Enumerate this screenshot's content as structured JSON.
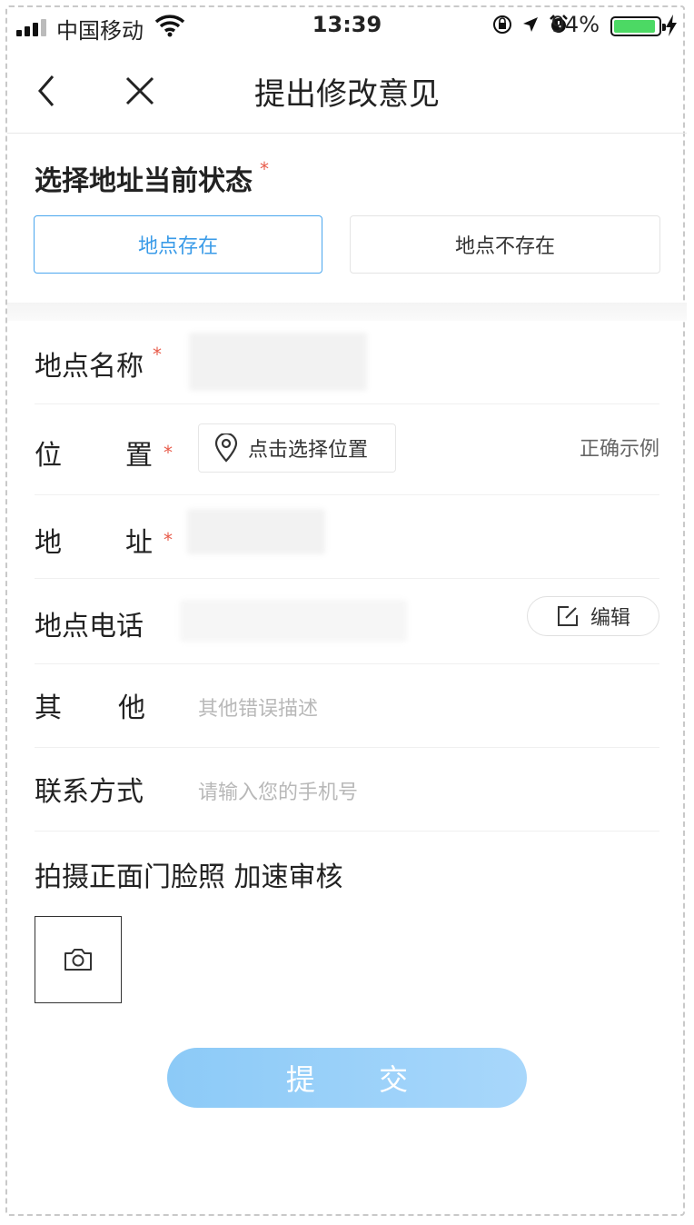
{
  "status_bar": {
    "carrier": "中国移动",
    "time": "13:39",
    "battery_pct": "94%",
    "battery_level": 0.94
  },
  "nav": {
    "title": "提出修改意见"
  },
  "status_section": {
    "title": "选择地址当前状态",
    "required_mark": "*",
    "options": [
      {
        "label": "地点存在",
        "selected": true
      },
      {
        "label": "地点不存在",
        "selected": false
      }
    ]
  },
  "form": {
    "name": {
      "label": "地点名称",
      "required_mark": "*"
    },
    "position": {
      "label_chars": [
        "位",
        "置"
      ],
      "required_mark": "*",
      "button": "点击选择位置",
      "example_link": "正确示例"
    },
    "address": {
      "label_chars": [
        "地",
        "址"
      ],
      "required_mark": "*"
    },
    "phone": {
      "label": "地点电话",
      "edit_button": "编辑"
    },
    "other": {
      "label_chars": [
        "其",
        "他"
      ],
      "placeholder": "其他错误描述"
    },
    "contact": {
      "label": "联系方式",
      "placeholder": "请输入您的手机号"
    }
  },
  "photo": {
    "title": "拍摄正面门脸照 加速审核"
  },
  "submit": {
    "label": "提 交"
  },
  "colors": {
    "accent": "#3a9be8",
    "required": "#e85b4a",
    "submit_bg": "#a8d7fb",
    "battery": "#4cd964"
  },
  "icons": [
    "signal-icon",
    "wifi-icon",
    "orientation-lock-icon",
    "location-arrow-icon",
    "alarm-icon",
    "battery-icon",
    "charging-icon",
    "back-icon",
    "close-icon",
    "map-pin-icon",
    "edit-icon",
    "camera-icon"
  ]
}
